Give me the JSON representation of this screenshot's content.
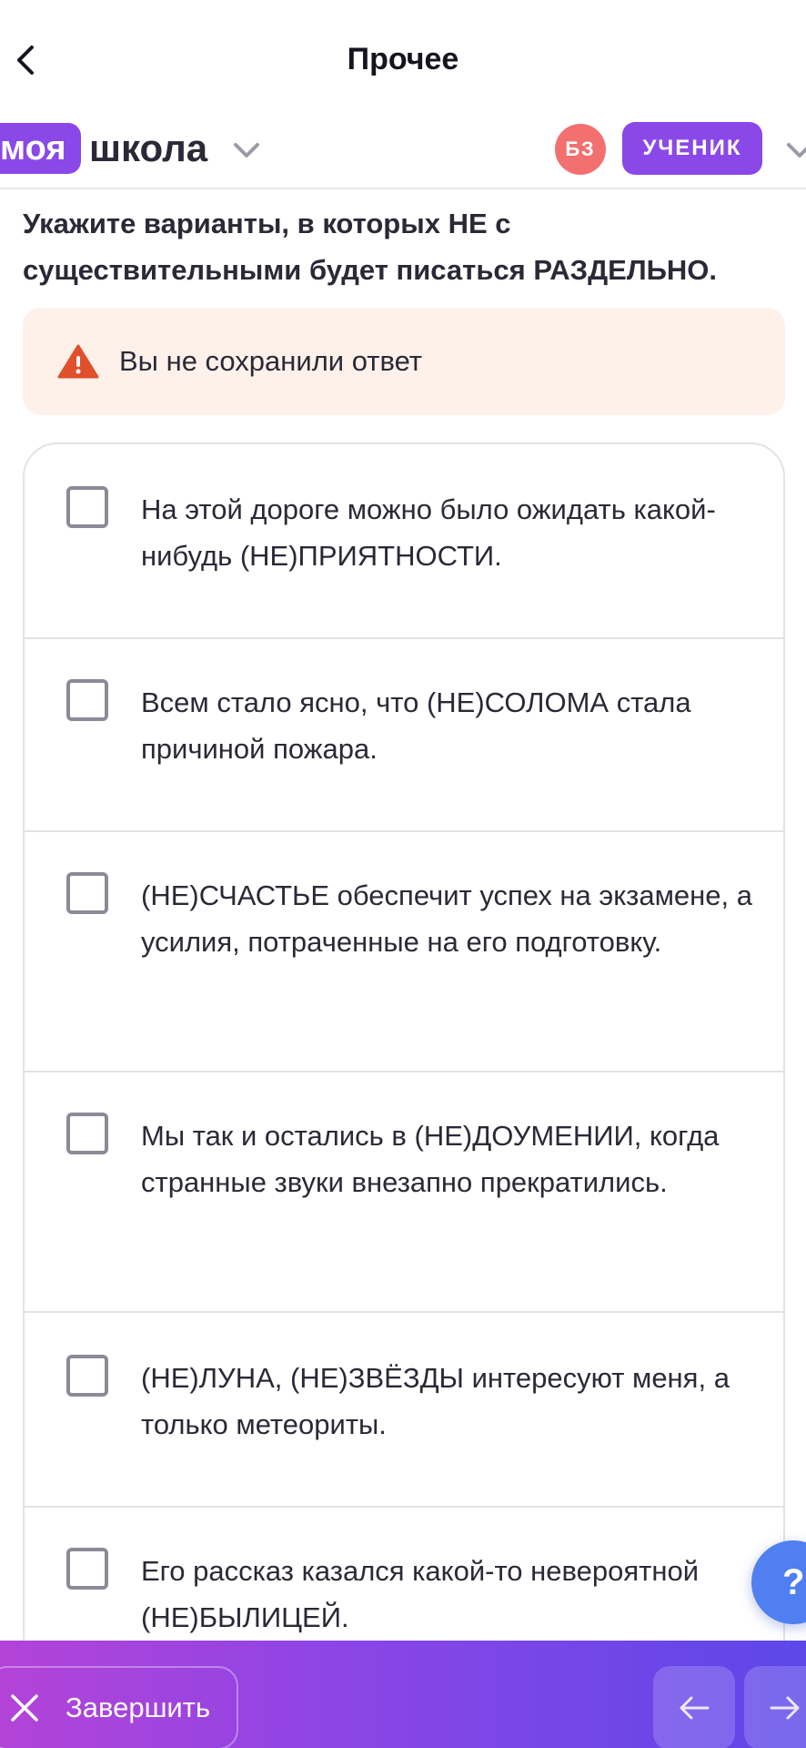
{
  "header": {
    "title": "Прочее"
  },
  "brand": {
    "pill": "моя",
    "word": "школа"
  },
  "user": {
    "initials": "БЗ",
    "role": "УЧЕНИК"
  },
  "question": {
    "text": "Укажите варианты, в которых НЕ с существительными будет писаться РАЗДЕЛЬНО."
  },
  "warning": {
    "text": "Вы не сохранили ответ"
  },
  "options": [
    {
      "text": "На этой дороге можно было ожидать какой-нибудь (НЕ)ПРИЯТНОСТИ.",
      "checked": false
    },
    {
      "text": "Всем стало ясно, что (НЕ)СОЛОМА стала причиной пожара.",
      "checked": false
    },
    {
      "text": "(НЕ)СЧАСТЬЕ обеспечит успех на экзамене, а усилия, потраченные на его подготовку.",
      "checked": false
    },
    {
      "text": "Мы так и остались в (НЕ)ДОУМЕНИИ, когда странные звуки внезапно прекратились.",
      "checked": false
    },
    {
      "text": "(НЕ)ЛУНА, (НЕ)ЗВЁЗДЫ интересуют меня, а только метеориты.",
      "checked": false
    },
    {
      "text": "Его рассказ казался какой-то невероятной (НЕ)БЫЛИЦЕЙ.",
      "checked": false
    }
  ],
  "help": {
    "label": "?"
  },
  "footer": {
    "finish_label": "Завершить"
  },
  "colors": {
    "accent": "#8a48e8",
    "avatar": "#f2706f",
    "warning_bg": "#fdf1ea",
    "warning_icon": "#e0502a",
    "help": "#4f7ff0"
  },
  "icons": {
    "back": "chevron-left-icon",
    "dropdown": "chevron-down-icon",
    "warning": "warning-triangle-icon",
    "finish": "close-icon",
    "prev": "arrow-left-icon",
    "next": "arrow-right-icon"
  }
}
